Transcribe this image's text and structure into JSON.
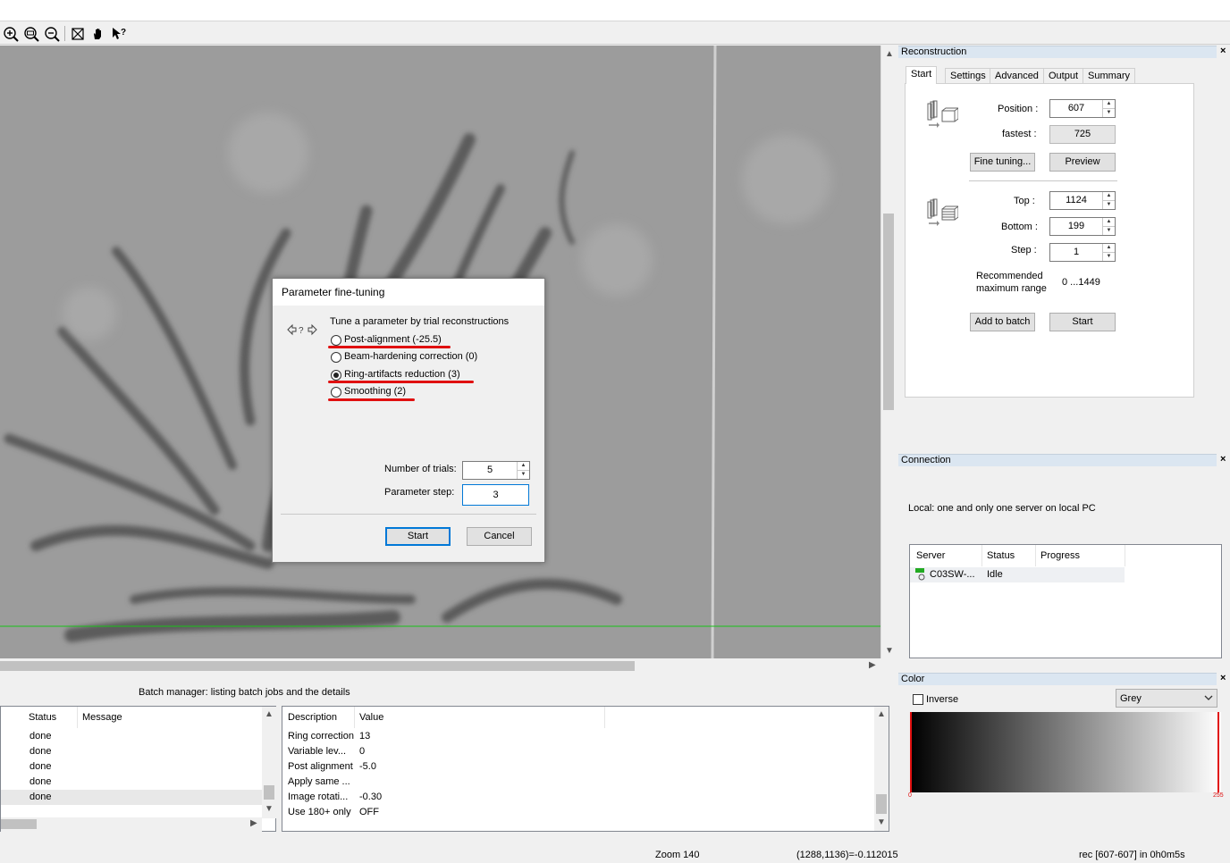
{
  "toolbar": {
    "icons": [
      "zoom-in-icon",
      "zoom-actual-icon",
      "zoom-out-icon",
      "fit-icon",
      "hand-icon",
      "help-pointer-icon"
    ]
  },
  "reconstruction": {
    "title": "Reconstruction",
    "tabs": [
      "Start",
      "Settings",
      "Advanced",
      "Output",
      "Summary"
    ],
    "position_label": "Position :",
    "position_value": "607",
    "fastest_label": "fastest :",
    "fastest_value": "725",
    "fine_tuning_label": "Fine tuning...",
    "preview_label": "Preview",
    "top_label": "Top :",
    "top_value": "1124",
    "bottom_label": "Bottom :",
    "bottom_value": "199",
    "step_label": "Step :",
    "step_value": "1",
    "recommended_label_1": "Recommended",
    "recommended_label_2": "maximum range",
    "recommended_value": "0 ...1449",
    "add_to_batch_label": "Add to batch",
    "start_label": "Start"
  },
  "connection": {
    "title": "Connection",
    "info": "Local: one and only one  server on local PC",
    "columns": [
      "Server",
      "Status",
      "Progress"
    ],
    "rows": [
      {
        "server": "C03SW-...",
        "status": "Idle",
        "progress": ""
      }
    ]
  },
  "color": {
    "title": "Color",
    "inverse_label": "Inverse",
    "palette": "Grey",
    "min": "0",
    "max": "255",
    "marker_color": "#e01010"
  },
  "dialog": {
    "title": "Parameter fine-tuning",
    "intro": "Tune a parameter by trial reconstructions",
    "options": [
      {
        "label": "Post-alignment (-25.5)",
        "selected": false,
        "underlined": true
      },
      {
        "label": "Beam-hardening correction (0)",
        "selected": false,
        "underlined": false
      },
      {
        "label": "Ring-artifacts reduction (3)",
        "selected": true,
        "underlined": true
      },
      {
        "label": "Smoothing (2)",
        "selected": false,
        "underlined": true
      }
    ],
    "trials_label": "Number of trials:",
    "trials_value": "5",
    "step_label": "Parameter step:",
    "step_value": "3",
    "start_label": "Start",
    "cancel_label": "Cancel"
  },
  "batch": {
    "header": "Batch manager:  listing batch jobs and the details",
    "jobs_columns": [
      "Status",
      "Message"
    ],
    "jobs": [
      "done",
      "done",
      "done",
      "done",
      "done"
    ],
    "details_columns": [
      "Description",
      "Value"
    ],
    "details": [
      {
        "desc": "Ring correction",
        "value": "13"
      },
      {
        "desc": "Variable lev...",
        "value": "0"
      },
      {
        "desc": "Post alignment",
        "value": "-5.0"
      },
      {
        "desc": "Apply same ...",
        "value": ""
      },
      {
        "desc": "Image rotati...",
        "value": "-0.30"
      },
      {
        "desc": "Use 180+ only",
        "value": "OFF"
      }
    ]
  },
  "status": {
    "zoom": "Zoom 140",
    "coords": "(1288,1136)=-0.112015",
    "rec": "rec [607-607] in 0h0m5s"
  }
}
